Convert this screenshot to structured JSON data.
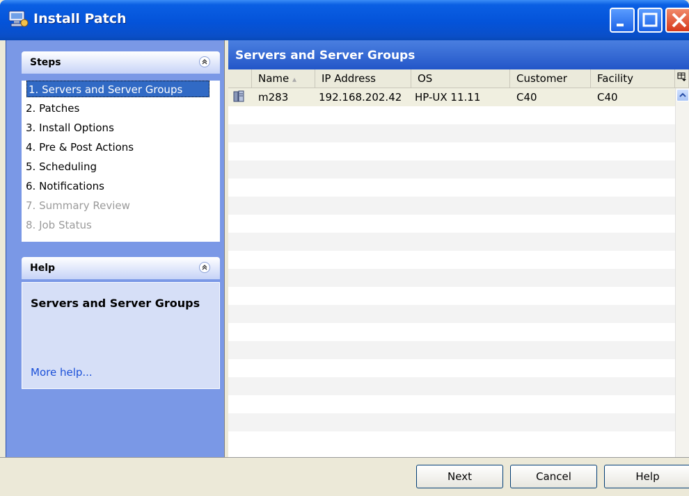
{
  "window": {
    "title": "Install Patch",
    "icon": "patch-install-icon"
  },
  "steps_panel": {
    "header": "Steps",
    "items": [
      {
        "label": "1. Servers and Server Groups",
        "state": "selected"
      },
      {
        "label": "2. Patches",
        "state": "enabled"
      },
      {
        "label": "3. Install Options",
        "state": "enabled"
      },
      {
        "label": "4. Pre & Post Actions",
        "state": "enabled"
      },
      {
        "label": "5. Scheduling",
        "state": "enabled"
      },
      {
        "label": "6. Notifications",
        "state": "enabled"
      },
      {
        "label": "7. Summary Review",
        "state": "disabled"
      },
      {
        "label": "8. Job Status",
        "state": "disabled"
      }
    ]
  },
  "help_panel": {
    "header": "Help",
    "title": "Servers and Server Groups",
    "link": "More help..."
  },
  "main": {
    "header": "Servers and Server Groups",
    "columns": [
      "Name",
      "IP Address",
      "OS",
      "Customer",
      "Facility"
    ],
    "sort_indicator": "▴",
    "rows": [
      {
        "icon": "server-icon",
        "name": "m283",
        "ip": "192.168.202.42",
        "os": "HP-UX 11.11",
        "customer": "C40",
        "facility": "C40"
      }
    ]
  },
  "buttons": {
    "next": "Next",
    "cancel": "Cancel",
    "help": "Help"
  },
  "colors": {
    "accent": "#316ac5",
    "titlebar": "#0453d9",
    "panel_bg": "#7a98e6",
    "link": "#1a4fd8"
  }
}
